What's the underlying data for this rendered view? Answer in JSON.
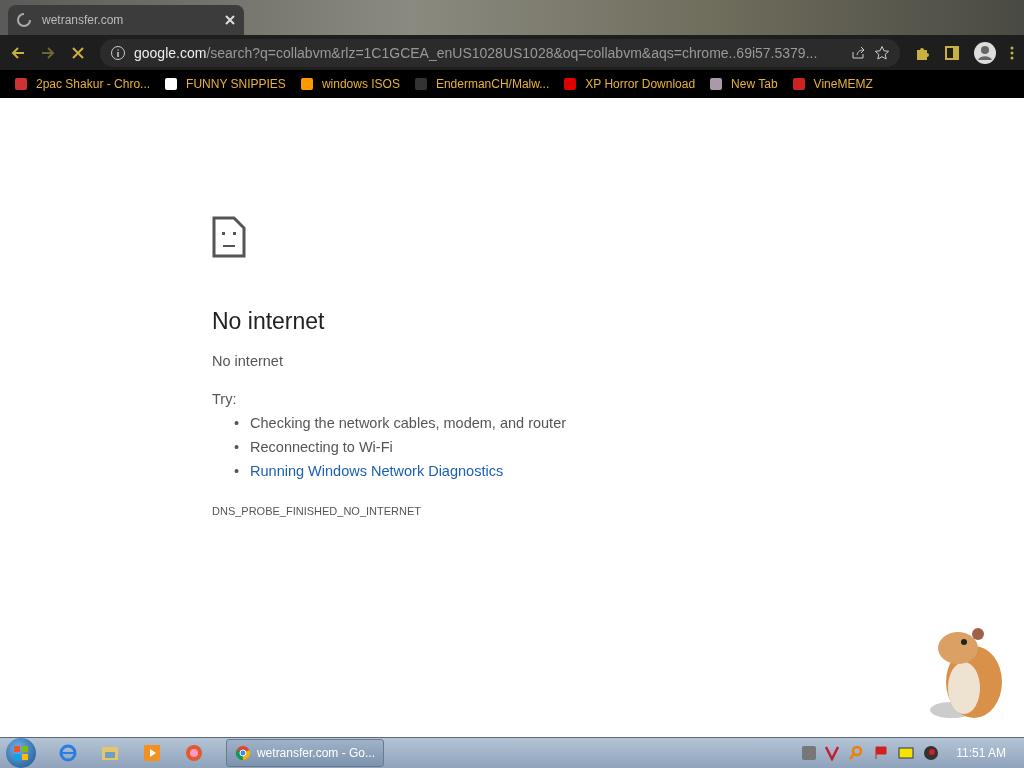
{
  "tab": {
    "title": "wetransfer.com"
  },
  "address_bar": {
    "domain": "google.com",
    "path": "/search?q=collabvm&rlz=1C1GCEA_enUS1028US1028&oq=collabvm&aqs=chrome..69i57.5379..."
  },
  "bookmarks": [
    {
      "label": "2pac Shakur - Chro..."
    },
    {
      "label": "FUNNY SNIPPIES"
    },
    {
      "label": "windows ISOS"
    },
    {
      "label": "EndermanCH/Malw..."
    },
    {
      "label": "XP Horror Download"
    },
    {
      "label": "New Tab"
    },
    {
      "label": "VineMEMZ"
    }
  ],
  "error": {
    "title": "No internet",
    "subtitle": "No internet",
    "try_label": "Try:",
    "suggestions": [
      {
        "kind": "text",
        "marker": "•",
        "text": "Checking the network cables, modem, and router"
      },
      {
        "kind": "text",
        "marker": "•",
        "text": "Reconnecting to Wi-Fi"
      },
      {
        "kind": "link",
        "marker": "•",
        "text": "Running Windows Network Diagnostics"
      }
    ],
    "code": "DNS_PROBE_FINISHED_NO_INTERNET"
  },
  "taskbar": {
    "window_button": {
      "label": "wetransfer.com - Go..."
    },
    "clock": "11:51 AM"
  }
}
